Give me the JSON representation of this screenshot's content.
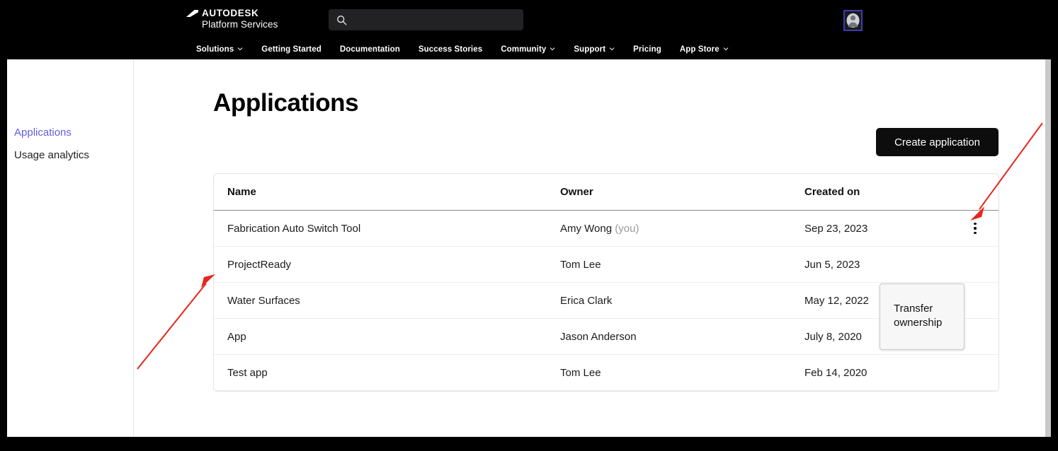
{
  "brand": {
    "name": "AUTODESK",
    "sub": "Platform Services",
    "logo_icon": "autodesk-logo-icon"
  },
  "search": {
    "value": "",
    "placeholder": "",
    "icon": "search-icon"
  },
  "account": {
    "avatar_icon": "user-avatar-icon"
  },
  "nav": {
    "items": [
      {
        "label": "Solutions",
        "has_caret": true
      },
      {
        "label": "Getting Started",
        "has_caret": false
      },
      {
        "label": "Documentation",
        "has_caret": false
      },
      {
        "label": "Success Stories",
        "has_caret": false
      },
      {
        "label": "Community",
        "has_caret": true
      },
      {
        "label": "Support",
        "has_caret": true
      },
      {
        "label": "Pricing",
        "has_caret": false
      },
      {
        "label": "App Store",
        "has_caret": true
      }
    ]
  },
  "sidebar": {
    "items": [
      {
        "label": "Applications",
        "active": true
      },
      {
        "label": "Usage analytics",
        "active": false
      }
    ]
  },
  "main": {
    "title": "Applications",
    "create_button": "Create application"
  },
  "table": {
    "columns": [
      "Name",
      "Owner",
      "Created on"
    ],
    "rows": [
      {
        "name": "Fabrication Auto Switch Tool",
        "owner": "Amy Wong",
        "owner_suffix": "(you)",
        "created_on": "Sep 23, 2023"
      },
      {
        "name": "ProjectReady",
        "owner": "Tom Lee",
        "owner_suffix": "",
        "created_on": "Jun 5, 2023"
      },
      {
        "name": "Water Surfaces",
        "owner": "Erica Clark",
        "owner_suffix": "",
        "created_on": "May 12, 2022"
      },
      {
        "name": "App",
        "owner": "Jason Anderson",
        "owner_suffix": "",
        "created_on": "July 8, 2020"
      },
      {
        "name": "Test app",
        "owner": "Tom Lee",
        "owner_suffix": "",
        "created_on": "Feb 14, 2020"
      }
    ]
  },
  "dropdown": {
    "items": [
      "Transfer ownership"
    ]
  },
  "annotations": {
    "arrow_color": "#e8261c",
    "arrows": [
      {
        "name": "arrow-to-kebab-menu"
      },
      {
        "name": "arrow-to-projectready-row"
      }
    ]
  },
  "colors": {
    "header_bg": "#000000",
    "accent_link": "#5f5fe0",
    "button_bg": "#0d0d0d"
  }
}
